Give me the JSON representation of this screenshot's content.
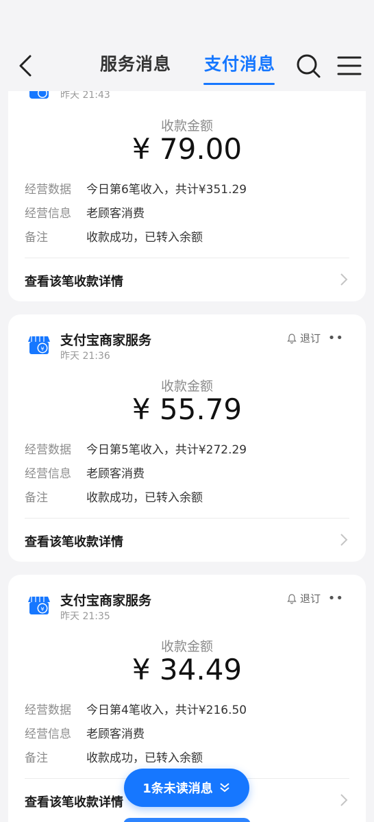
{
  "header": {
    "tab_service": "服务消息",
    "tab_pay": "支付消息",
    "active_tab": "支付消息"
  },
  "card1": {
    "time": "昨天 21:43",
    "amount_label": "收款金额",
    "amount": "¥ 79.00",
    "rows": [
      {
        "k": "经营数据",
        "v": "今日第6笔收入，共计¥351.29"
      },
      {
        "k": "经营信息",
        "v": "老顾客消费"
      },
      {
        "k": "备注",
        "v": "收款成功，已转入余额"
      }
    ],
    "detail": "查看该笔收款详情"
  },
  "card2": {
    "service": "支付宝商家服务",
    "time": "昨天 21:36",
    "unsubscribe": "退订",
    "more": "••",
    "amount_label": "收款金额",
    "amount": "¥ 55.79",
    "rows": [
      {
        "k": "经营数据",
        "v": "今日第5笔收入，共计¥272.29"
      },
      {
        "k": "经营信息",
        "v": "老顾客消费"
      },
      {
        "k": "备注",
        "v": "收款成功，已转入余额"
      }
    ],
    "detail": "查看该笔收款详情"
  },
  "card3": {
    "service": "支付宝商家服务",
    "time": "昨天 21:35",
    "unsubscribe": "退订",
    "more": "••",
    "amount_label": "收款金额",
    "amount": "¥ 34.49",
    "rows": [
      {
        "k": "经营数据",
        "v": "今日第4笔收入，共计¥216.50"
      },
      {
        "k": "经营信息",
        "v": "老顾客消费"
      },
      {
        "k": "备注",
        "v": "收款成功，已转入余额"
      }
    ],
    "detail": "查看该笔收款详情"
  },
  "unread": {
    "label": "1条未读消息"
  },
  "colors": {
    "accent": "#1677ff",
    "background": "#f4f4f6"
  },
  "icons": [
    "back-arrow-icon",
    "search-icon",
    "menu-icon",
    "merchant-shop-icon",
    "bell-icon",
    "chevron-right-icon",
    "chevron-double-down-icon"
  ]
}
